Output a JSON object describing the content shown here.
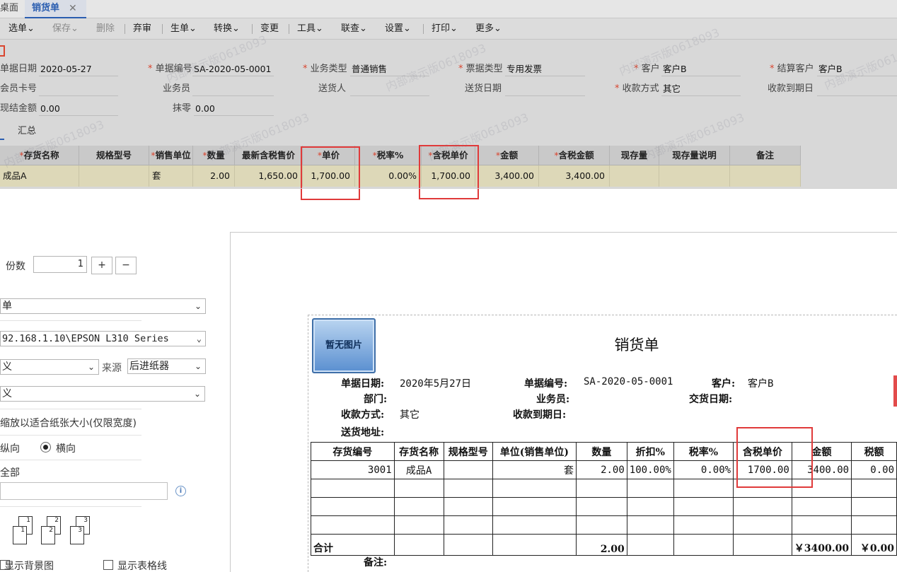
{
  "tabs": {
    "home": "桌面",
    "active": "销货单",
    "close": "✕"
  },
  "toolbar": {
    "select": "选单",
    "save": "保存",
    "delete": "删除",
    "abandon": "弃审",
    "generate": "生单",
    "convert": "转换",
    "change": "变更",
    "tools": "工具",
    "query": "联查",
    "settings": "设置",
    "print": "打印",
    "more": "更多",
    "chevron": "⌄"
  },
  "header": {
    "date_label": "单据日期",
    "date_value": "2020-05-27",
    "number_label": "单据编号",
    "number_value": "SA-2020-05-0001",
    "biztype_label": "业务类型",
    "biztype_value": "普通销售",
    "invoice_label": "票据类型",
    "invoice_value": "专用发票",
    "customer_label": "客户",
    "customer_value": "客户B",
    "settle_label": "结算客户",
    "settle_value": "客户B",
    "member_label": "会员卡号",
    "salesman_label": "业务员",
    "deliverer_label": "送货人",
    "delivery_date_label": "送货日期",
    "pay_method_label": "收款方式",
    "pay_method_value": "其它",
    "due_date_label": "收款到期日",
    "cash_label": "现结金额",
    "cash_value": "0.00",
    "rounding_label": "抹零",
    "rounding_value": "0.00",
    "summary_tab": "汇总"
  },
  "grid": {
    "columns": [
      "存货名称",
      "规格型号",
      "销售单位",
      "数量",
      "最新含税售价",
      "单价",
      "税率%",
      "含税单价",
      "金额",
      "含税金额",
      "现存量",
      "现存量说明",
      "备注"
    ],
    "row": {
      "name": "成品A",
      "spec": "",
      "unit": "套",
      "qty": "2.00",
      "latest_price": "1,650.00",
      "price": "1,700.00",
      "tax_rate": "0.00%",
      "tax_price": "1,700.00",
      "amount": "3,400.00",
      "tax_amount": "3,400.00",
      "stock": "",
      "stock_note": "",
      "memo": ""
    }
  },
  "print_panel": {
    "copies_label": "份数",
    "copies_value": "1",
    "plus": "+",
    "minus": "−",
    "template_value": "单",
    "printer_value": "92.168.1.10\\EPSON L310 Series",
    "paper_value": "义",
    "source_label": "来源",
    "source_value": "后进纸器",
    "paper2_value": "义",
    "scale_option": "缩放以适合纸张大小(仅限宽度)",
    "portrait_label": "纵向",
    "landscape_label": "横向",
    "range_label": "全部",
    "info": "i",
    "collate_pages": [
      "1",
      "2",
      "3"
    ],
    "show_bg_label": "显示背景图",
    "show_grid_label": "显示表格线"
  },
  "watermark_text": "内部演示版0618093",
  "preview": {
    "no_image": "暂无图片",
    "title": "销货单",
    "date_label": "单据日期:",
    "date_value": "2020年5月27日",
    "number_label": "单据编号:",
    "number_value": "SA-2020-05-0001",
    "customer_label": "客户:",
    "customer_value": "客户B",
    "dept_label": "部门:",
    "salesman_label": "业务员:",
    "delivery_date_label": "交货日期:",
    "pay_method_label": "收款方式:",
    "pay_method_value": "其它",
    "due_date_label": "收款到期日:",
    "address_label": "送货地址:",
    "columns": [
      "存货编号",
      "存货名称",
      "规格型号",
      "单位(销售单位)",
      "数量",
      "折扣%",
      "税率%",
      "含税单价",
      "金额",
      "税额"
    ],
    "row": {
      "code": "3001",
      "name": "成品A",
      "spec": "",
      "unit": "套",
      "qty": "2.00",
      "discount": "100.00%",
      "tax_rate": "0.00%",
      "tax_price": "1700.00",
      "amount": "3400.00",
      "tax": "0.00"
    },
    "total_label": "合计",
    "total_qty": "2.00",
    "total_amount": "￥3400.00",
    "total_tax": "￥0.00",
    "memo_label": "备注:"
  }
}
